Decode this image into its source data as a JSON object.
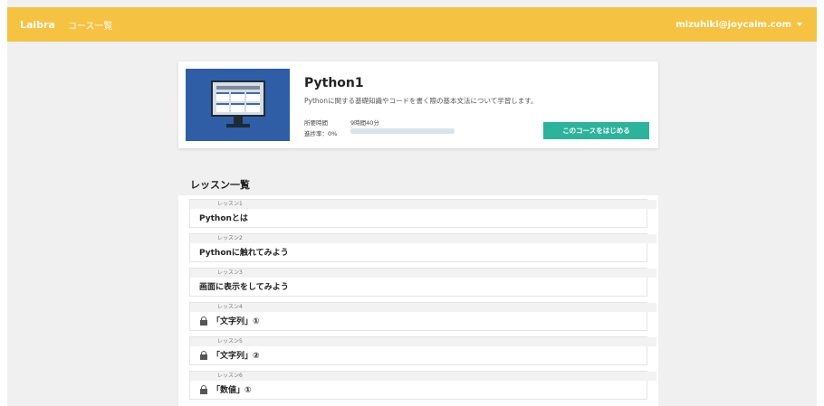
{
  "navbar": {
    "brand": "Laibra",
    "course_list_link": "コース一覧",
    "user_email": "mizuhiki@joycalm.com"
  },
  "course": {
    "title": "Python1",
    "description": "Pythonに関する基礎知識やコードを書く際の基本文法について学習します。",
    "required_time_label": "所要時間",
    "required_time_value": "9時間40分",
    "progress_label": "進捗率：0%",
    "progress_percent": 0,
    "start_button": "このコースをはじめる"
  },
  "lessons_section_title": "レッスン一覧",
  "lessons": [
    {
      "number": "レッスン1",
      "title": "Pythonとは",
      "locked": false
    },
    {
      "number": "レッスン2",
      "title": "Pythonに触れてみよう",
      "locked": false
    },
    {
      "number": "レッスン3",
      "title": "画面に表示をしてみよう",
      "locked": false
    },
    {
      "number": "レッスン4",
      "title": "「文字列」①",
      "locked": true
    },
    {
      "number": "レッスン5",
      "title": "「文字列」②",
      "locked": true
    },
    {
      "number": "レッスン6",
      "title": "「数値」①",
      "locked": true
    }
  ],
  "colors": {
    "navbar": "#f5c242",
    "thumbnail": "#2f5ea6",
    "start_button": "#2bb39b"
  }
}
